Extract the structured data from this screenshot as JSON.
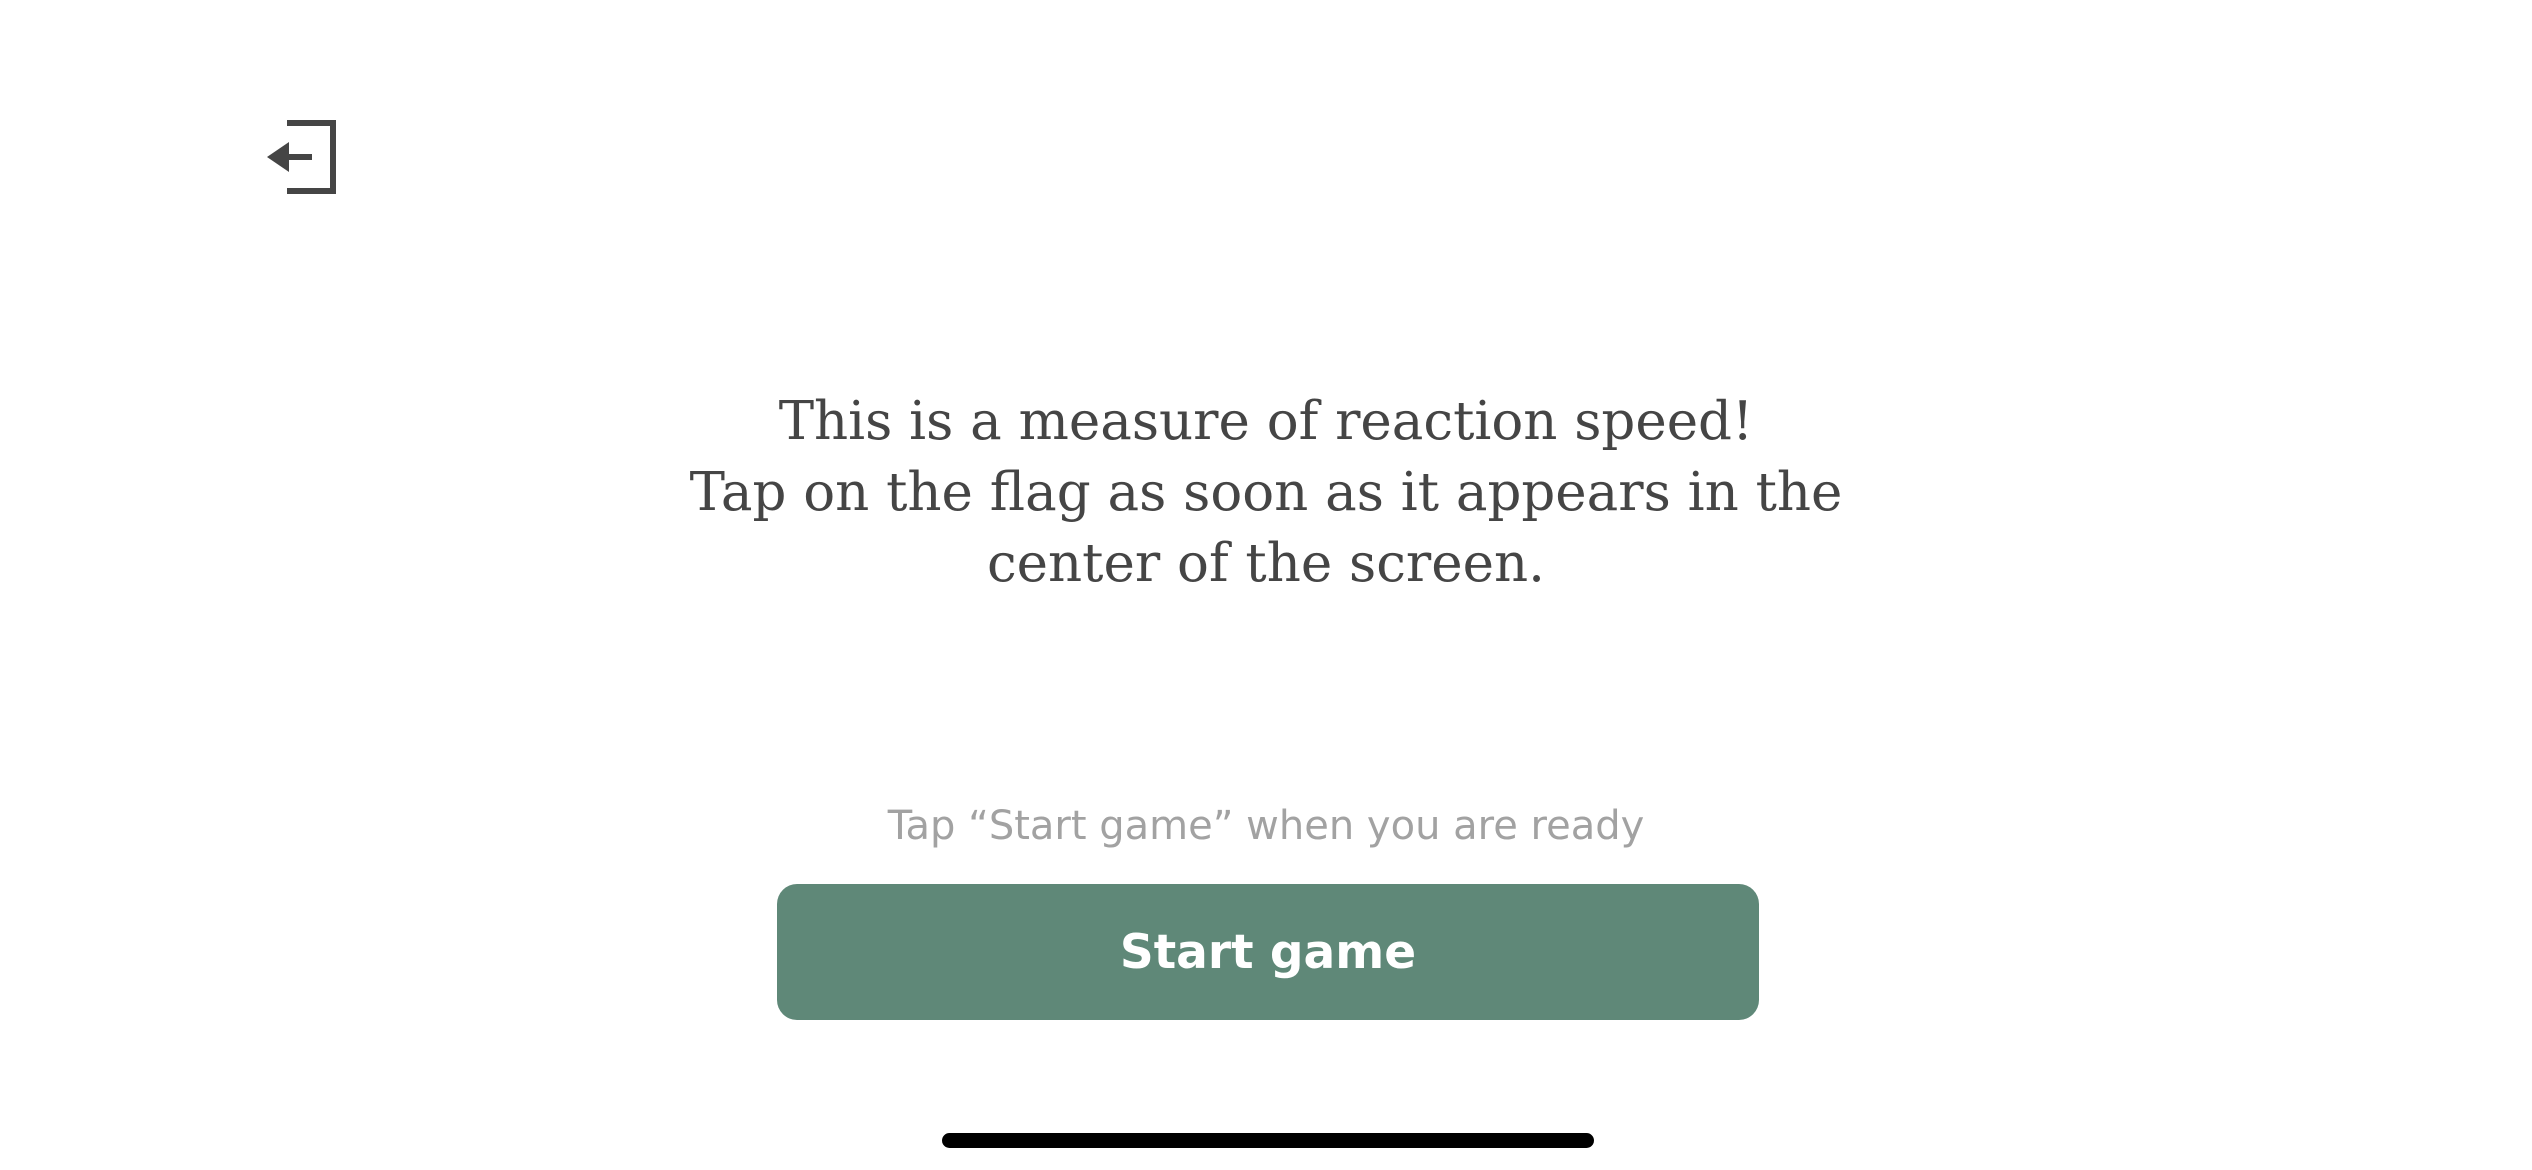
{
  "header": {
    "exit_icon": "exit-arrow-left-icon"
  },
  "main": {
    "instructions": [
      "This is a measure of reaction speed!",
      "Tap on the flag as soon as it appears in the",
      "center of the screen."
    ],
    "hint": "Tap “Start game” when you are ready",
    "start_button_label": "Start game"
  },
  "colors": {
    "accent": "#5f8878",
    "text": "#454545",
    "hint_text": "#a2a2a2",
    "background": "#ffffff"
  }
}
